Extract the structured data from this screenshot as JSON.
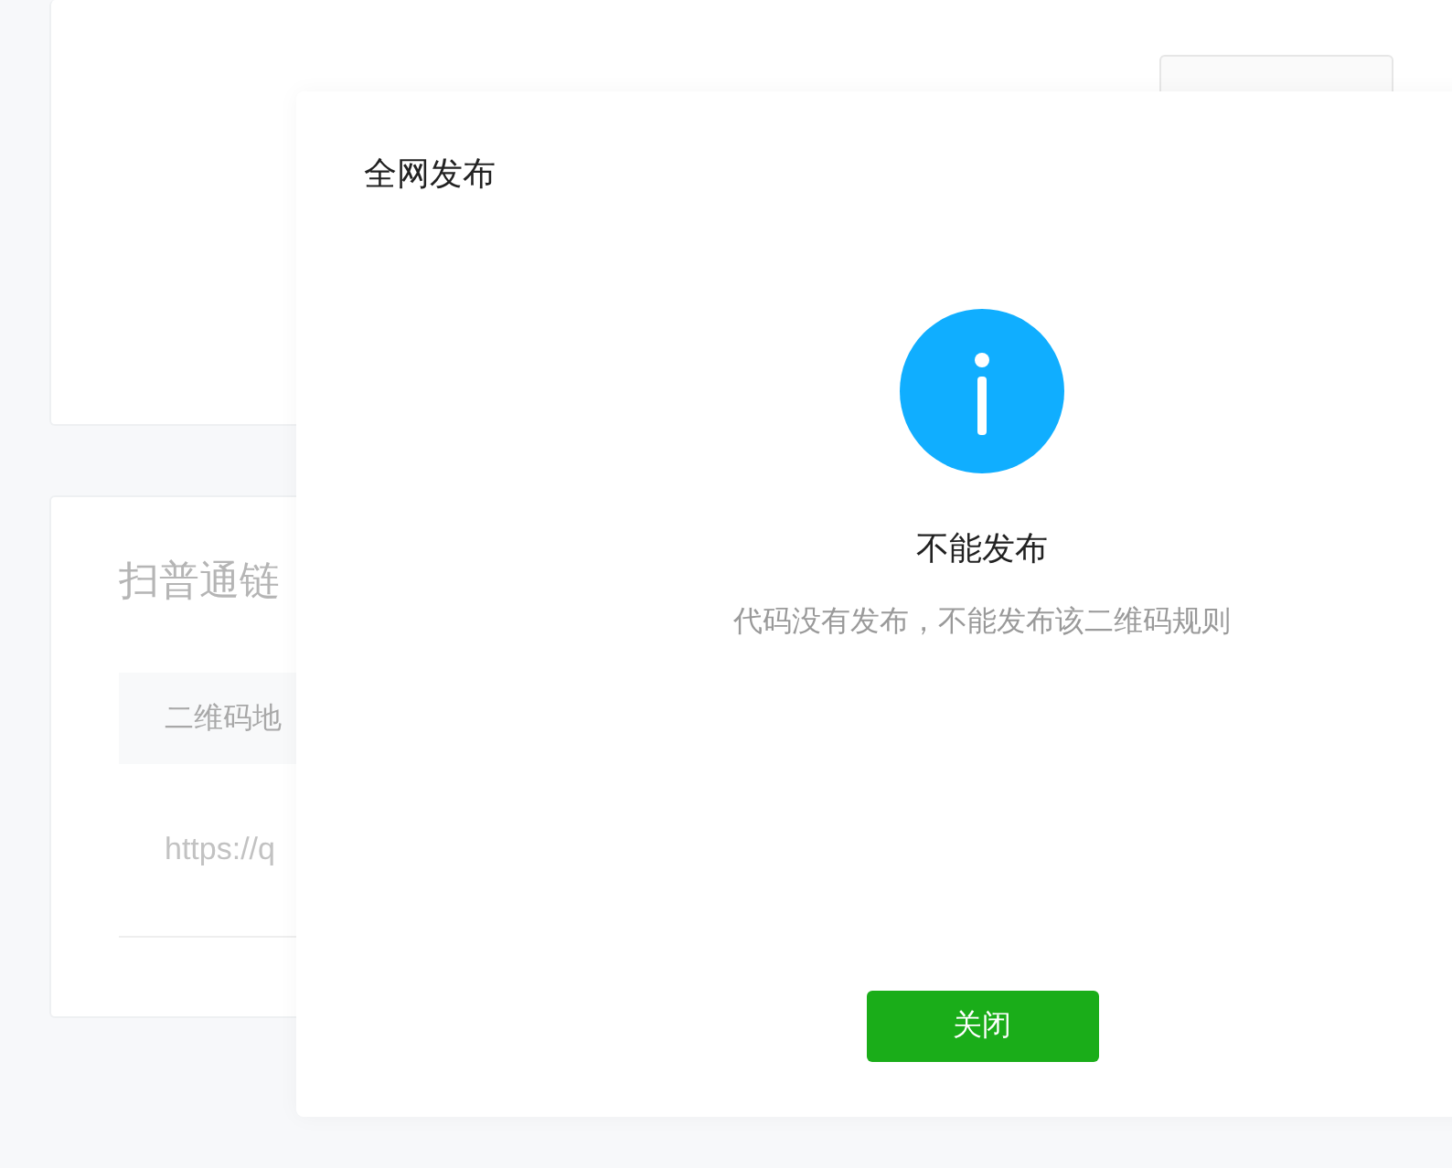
{
  "background_card": {
    "section_title": "扫普通链",
    "table": {
      "column_1": "二维码地",
      "row_1": "https://q"
    }
  },
  "dialog": {
    "title": "全网发布",
    "icon": {
      "kind": "info"
    },
    "message_title": "不能发布",
    "message": "代码没有发布，不能发布该二维码规则",
    "buttons": [
      {
        "label": "关闭",
        "kind": "primary"
      }
    ]
  }
}
